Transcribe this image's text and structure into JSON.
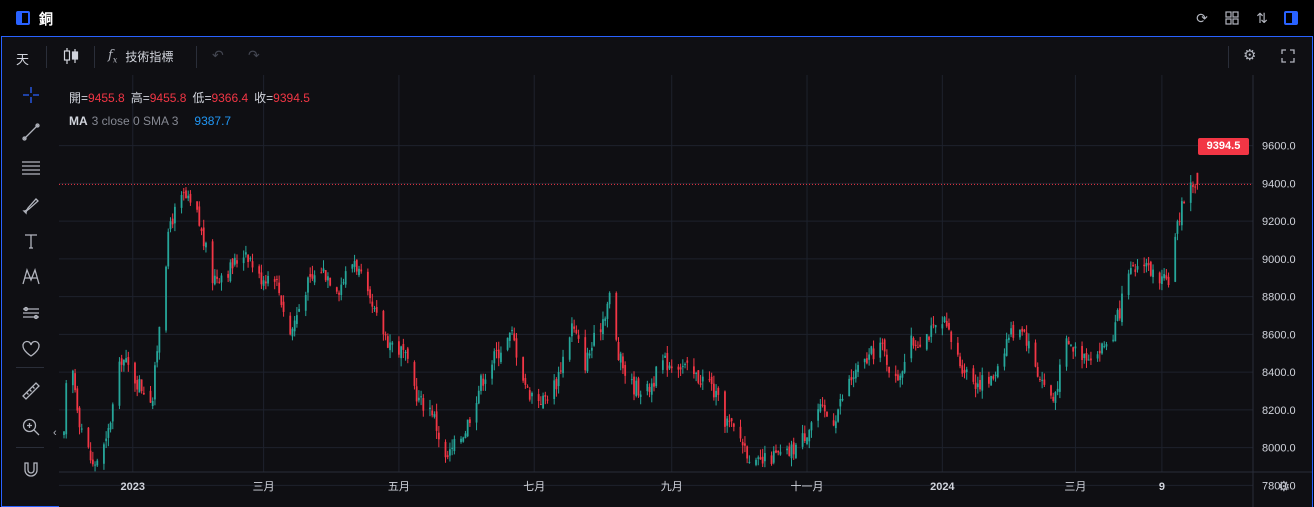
{
  "window": {
    "title": "銅"
  },
  "toolbar": {
    "interval": "天",
    "indicators_label": "技術指標"
  },
  "legend": {
    "open_label": "開=",
    "open": "9455.8",
    "high_label": "高=",
    "high": "9455.8",
    "low_label": "低=",
    "low": "9366.4",
    "close_label": "收=",
    "close": "9394.5",
    "ma_name": "MA",
    "ma_params": "3 close 0 SMA 3",
    "ma_value": "9387.7"
  },
  "last_price": "9394.5",
  "colors": {
    "up": "#26a69a",
    "down": "#f23645",
    "accent": "#2962ff",
    "ma": "#2196f3",
    "grid": "#1e222d",
    "background": "#0f0f13"
  },
  "icons": {
    "title_left": "panel-left-icon",
    "refresh": "refresh-icon",
    "layout": "grid-icon",
    "compare": "sort-arrows-icon",
    "title_right": "panel-right-icon",
    "chart_type": "candlestick-icon",
    "undo": "undo-icon",
    "redo": "redo-icon",
    "settings": "gear-icon",
    "fullscreen": "fullscreen-icon",
    "drawing_tools": [
      "crosshair-icon",
      "trend-line-icon",
      "fib-lines-icon",
      "brush-icon",
      "text-icon",
      "pattern-icon",
      "projection-icon",
      "heart-icon",
      "ruler-icon",
      "zoom-in-icon",
      "magnet-icon"
    ]
  },
  "chart_data": {
    "type": "candlestick",
    "title": "",
    "y_axis": {
      "position": "right",
      "ylim": [
        7700,
        9700
      ],
      "ticks": [
        "7800.0",
        "8000.0",
        "8200.0",
        "8400.0",
        "8600.0",
        "8800.0",
        "9000.0",
        "9200.0",
        "9400.0",
        "9600.0"
      ]
    },
    "x_axis": {
      "ticks": [
        "2023",
        "三月",
        "五月",
        "七月",
        "九月",
        "十一月",
        "2024",
        "三月",
        "9"
      ],
      "bold_ticks": [
        "2023",
        "2024",
        "9"
      ]
    },
    "grid": true,
    "last_price_line": 9394.5,
    "series": [
      {
        "name": "OHLC",
        "note": "daily candles, values estimated from the rendered chart",
        "approx_close_path": [
          [
            "2022-12-01",
            8050
          ],
          [
            "2022-12-03",
            8560
          ],
          [
            "2022-12-08",
            8150
          ],
          [
            "2022-12-14",
            7900
          ],
          [
            "2022-12-20",
            8020
          ],
          [
            "2022-12-27",
            8480
          ],
          [
            "2023-01-03",
            8350
          ],
          [
            "2023-01-10",
            8260
          ],
          [
            "2023-01-14",
            8800
          ],
          [
            "2023-01-18",
            9200
          ],
          [
            "2023-01-24",
            9330
          ],
          [
            "2023-01-30",
            9230
          ],
          [
            "2023-02-06",
            8900
          ],
          [
            "2023-02-14",
            8950
          ],
          [
            "2023-02-21",
            9050
          ],
          [
            "2023-02-27",
            8900
          ],
          [
            "2023-03-06",
            8920
          ],
          [
            "2023-03-13",
            8600
          ],
          [
            "2023-03-20",
            8850
          ],
          [
            "2023-03-27",
            8950
          ],
          [
            "2023-04-04",
            8850
          ],
          [
            "2023-04-11",
            9000
          ],
          [
            "2023-04-18",
            8750
          ],
          [
            "2023-04-26",
            8570
          ],
          [
            "2023-05-03",
            8500
          ],
          [
            "2023-05-10",
            8250
          ],
          [
            "2023-05-16",
            8200
          ],
          [
            "2023-05-22",
            7930
          ],
          [
            "2023-05-31",
            8100
          ],
          [
            "2023-06-07",
            8350
          ],
          [
            "2023-06-14",
            8500
          ],
          [
            "2023-06-21",
            8600
          ],
          [
            "2023-06-28",
            8300
          ],
          [
            "2023-07-05",
            8250
          ],
          [
            "2023-07-11",
            8350
          ],
          [
            "2023-07-18",
            8650
          ],
          [
            "2023-07-24",
            8450
          ],
          [
            "2023-07-31",
            8650
          ],
          [
            "2023-08-04",
            8800
          ],
          [
            "2023-08-08",
            8480
          ],
          [
            "2023-08-14",
            8330
          ],
          [
            "2023-08-21",
            8300
          ],
          [
            "2023-08-28",
            8450
          ],
          [
            "2023-09-04",
            8450
          ],
          [
            "2023-09-11",
            8380
          ],
          [
            "2023-09-18",
            8350
          ],
          [
            "2023-09-25",
            8150
          ],
          [
            "2023-10-02",
            8050
          ],
          [
            "2023-10-09",
            7900
          ],
          [
            "2023-10-16",
            7950
          ],
          [
            "2023-10-23",
            7960
          ],
          [
            "2023-10-30",
            8050
          ],
          [
            "2023-11-06",
            8200
          ],
          [
            "2023-11-13",
            8150
          ],
          [
            "2023-11-20",
            8350
          ],
          [
            "2023-11-27",
            8450
          ],
          [
            "2023-12-04",
            8550
          ],
          [
            "2023-12-11",
            8350
          ],
          [
            "2023-12-18",
            8550
          ],
          [
            "2023-12-25",
            8600
          ],
          [
            "2024-01-02",
            8650
          ],
          [
            "2024-01-09",
            8450
          ],
          [
            "2024-01-16",
            8350
          ],
          [
            "2024-01-23",
            8350
          ],
          [
            "2024-01-31",
            8600
          ],
          [
            "2024-02-06",
            8650
          ],
          [
            "2024-02-13",
            8400
          ],
          [
            "2024-02-20",
            8250
          ],
          [
            "2024-02-26",
            8550
          ],
          [
            "2024-03-04",
            8500
          ],
          [
            "2024-03-11",
            8500
          ],
          [
            "2024-03-18",
            8600
          ],
          [
            "2024-03-25",
            8900
          ],
          [
            "2024-04-01",
            9000
          ],
          [
            "2024-04-08",
            8850
          ],
          [
            "2024-04-12",
            8900
          ],
          [
            "2024-04-18",
            9300
          ],
          [
            "2024-04-23",
            9400
          ],
          [
            "2024-04-25",
            9394.5
          ]
        ]
      }
    ]
  }
}
